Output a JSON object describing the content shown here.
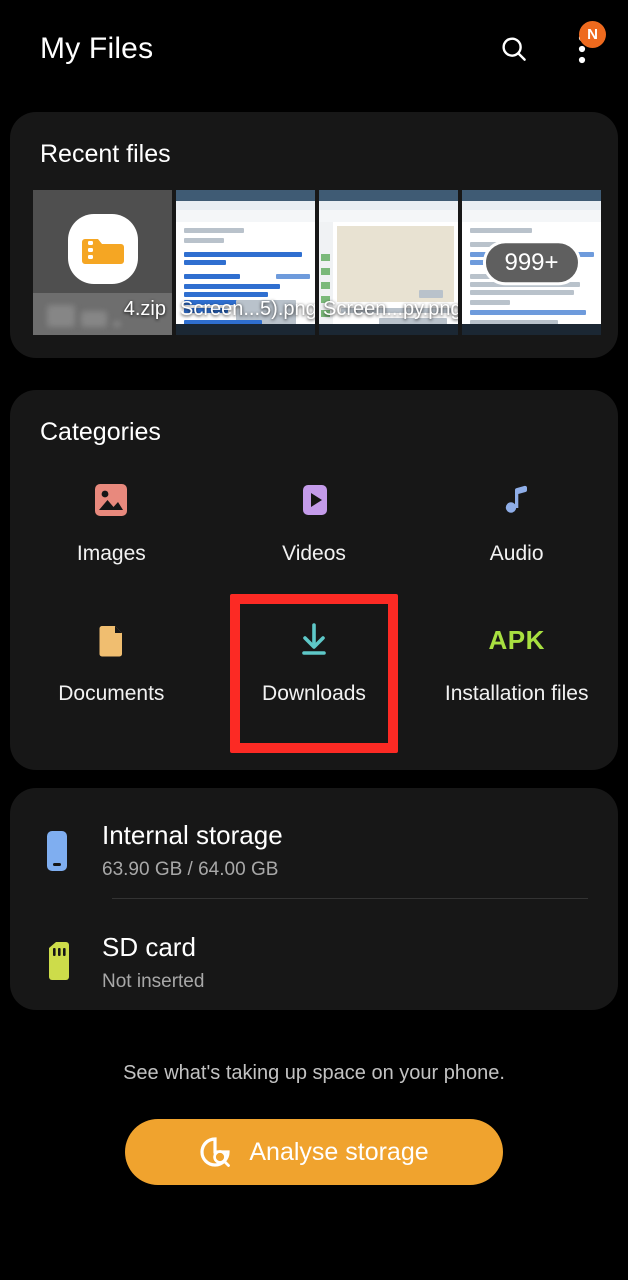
{
  "header": {
    "title": "My Files",
    "search_icon": "search-icon",
    "more_icon": "more-options-icon",
    "notification_badge": "N"
  },
  "recent": {
    "title": "Recent files",
    "items": [
      {
        "label": "4.zip",
        "icon": "zip-folder-icon",
        "overlay": ""
      },
      {
        "label": "Screen...5).png",
        "icon": "image-thumbnail",
        "overlay": ""
      },
      {
        "label": "Screen...py.png",
        "icon": "image-thumbnail",
        "overlay": ""
      },
      {
        "label": "",
        "icon": "image-thumbnail",
        "overlay": "999+"
      }
    ]
  },
  "categories": {
    "title": "Categories",
    "items": [
      {
        "label": "Images",
        "icon": "images-icon",
        "color": "#E8897D"
      },
      {
        "label": "Videos",
        "icon": "videos-icon",
        "color": "#C49BEA"
      },
      {
        "label": "Audio",
        "icon": "audio-icon",
        "color": "#8FAEE8"
      },
      {
        "label": "Documents",
        "icon": "documents-icon",
        "color": "#F0BE70"
      },
      {
        "label": "Downloads",
        "icon": "downloads-icon",
        "color": "#5EC8C8"
      },
      {
        "label": "Installation files",
        "icon": "apk-icon",
        "color": "#A8E040"
      }
    ],
    "highlight": "Downloads",
    "highlight_color": "#FC2A24"
  },
  "storage": {
    "items": [
      {
        "name": "Internal storage",
        "detail": "63.90 GB / 64.00 GB",
        "icon": "phone-icon",
        "color": "#7FAEF0"
      },
      {
        "name": "SD card",
        "detail": "Not inserted",
        "icon": "sd-card-icon",
        "color": "#CDDC4A"
      }
    ]
  },
  "footer": {
    "note": "See what's taking up space on your phone.",
    "button_label": "Analyse storage",
    "button_icon": "storage-analyse-icon",
    "button_color": "#F0A32E"
  }
}
